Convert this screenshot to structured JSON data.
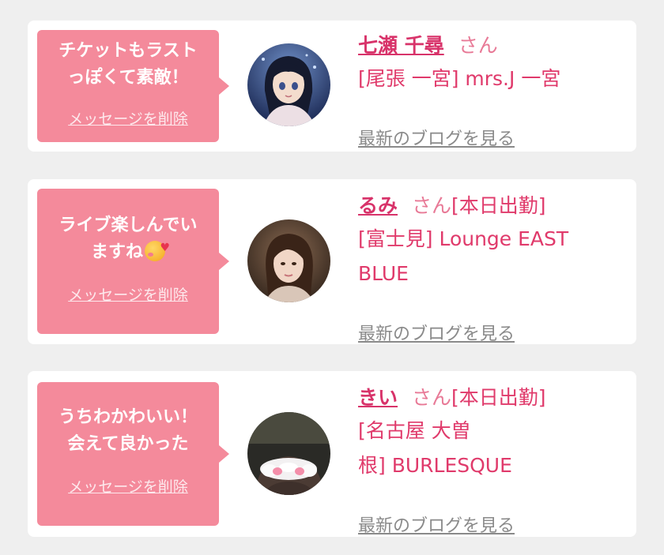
{
  "cards": [
    {
      "message": "チケットもラストっぽくて素敵！",
      "message_lines": [
        "チケットもラスト",
        "っぽくて素敵！"
      ],
      "delete_label": "メッセージを削除",
      "name": "七瀬 千尋",
      "honorific": "さん",
      "badge": "",
      "shop_lines": [
        "[尾張 一宮] mrs.J 一宮"
      ],
      "blog_label": "最新のブログを見る",
      "avatar_icon": "profile-photo"
    },
    {
      "message": "ライブ楽しんでいますね🥰",
      "message_lines": [
        "ライブ楽しんでい",
        "ますね"
      ],
      "emoji": "smiling-face-with-hearts-emoji",
      "delete_label": "メッセージを削除",
      "name": "るみ",
      "honorific": "さん",
      "badge": "[本日出勤]",
      "shop_lines": [
        "[富士見] Lounge EAST",
        "BLUE"
      ],
      "blog_label": "最新のブログを見る",
      "avatar_icon": "profile-photo"
    },
    {
      "message": "うちわかわいい！会えて良かった",
      "message_lines": [
        "うちわかわいい！",
        "会えて良かった"
      ],
      "delete_label": "メッセージを削除",
      "name": "きい",
      "honorific": "さん",
      "badge": "[本日出勤]",
      "shop_lines": [
        "[名古屋 大曽",
        "根] BURLESQUE"
      ],
      "blog_label": "最新のブログを見る",
      "avatar_icon": "profile-photo"
    }
  ],
  "colors": {
    "bubble": "#f48a9b",
    "accent_pink": "#e03a6b",
    "link_gray": "#8a8a8a",
    "background": "#efefef",
    "card": "#ffffff"
  }
}
